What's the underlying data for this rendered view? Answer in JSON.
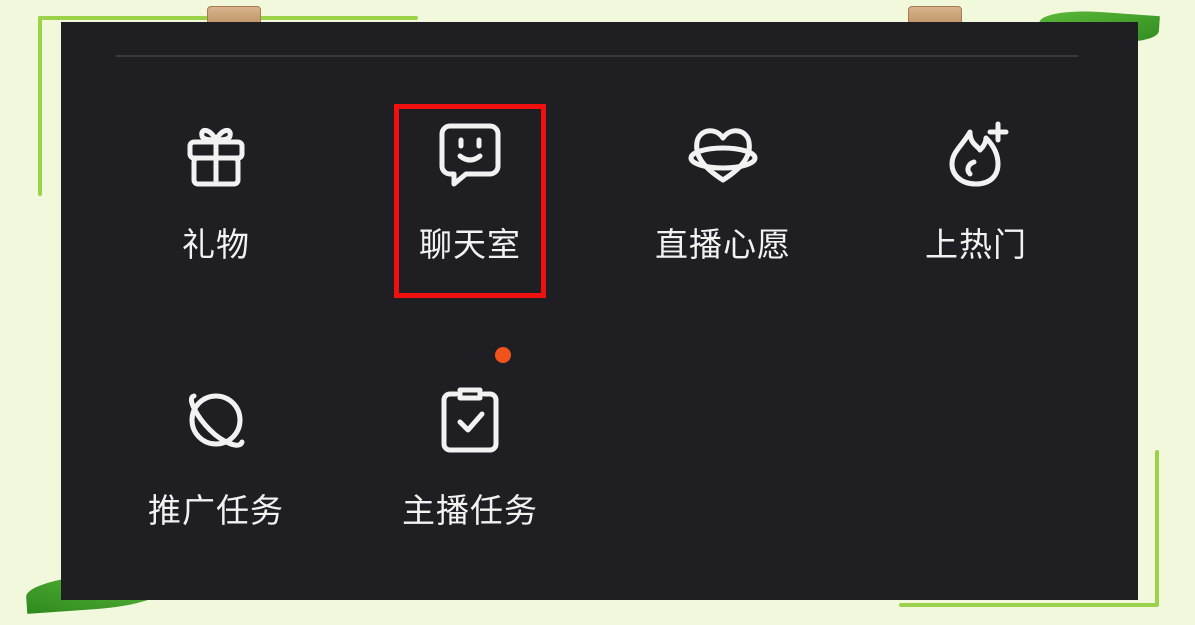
{
  "menu": {
    "items": [
      {
        "label": "礼物",
        "icon": "gift-icon"
      },
      {
        "label": "聊天室",
        "icon": "smile-chat-icon"
      },
      {
        "label": "直播心愿",
        "icon": "heart-ring-icon"
      },
      {
        "label": "上热门",
        "icon": "flame-plus-icon"
      },
      {
        "label": "推广任务",
        "icon": "planet-icon"
      },
      {
        "label": "主播任务",
        "icon": "clipboard-check-icon"
      }
    ]
  },
  "highlight_color": "#f01010",
  "badge_color": "#f2521c",
  "panel_color": "#1f1e23"
}
